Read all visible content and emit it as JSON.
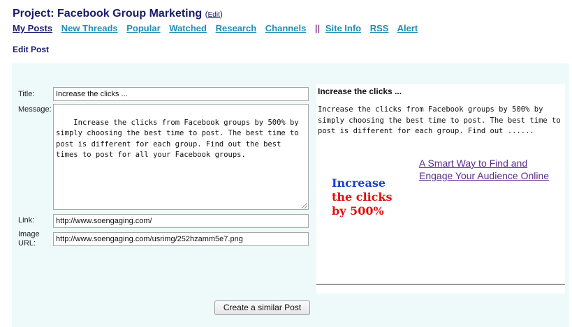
{
  "header": {
    "title": "Project: Facebook Group Marketing",
    "edit_label": "Edit",
    "paren_open": "(",
    "paren_close": ")"
  },
  "nav": {
    "items": [
      {
        "label": "My Posts"
      },
      {
        "label": "New Threads"
      },
      {
        "label": "Popular"
      },
      {
        "label": "Watched"
      },
      {
        "label": "Research"
      },
      {
        "label": "Channels"
      },
      {
        "label": "Site Info"
      },
      {
        "label": "RSS"
      },
      {
        "label": "Alert"
      }
    ],
    "separator": "||"
  },
  "section_title": "Edit Post",
  "form": {
    "title_label": "Title:",
    "title_value": "Increase the clicks ...",
    "message_label": "Message:",
    "message_value": "Increase the clicks from Facebook groups by 500% by simply choosing the best time to post. The best time to post is different for each group. Find out the best times to post for all your Facebook groups.",
    "link_label": "Link:",
    "link_value": "http://www.soengaging.com/",
    "image_label_1": "Image",
    "image_label_2": "URL:",
    "image_value": "http://www.soengaging.com/usrimg/252hzamm5e7.png",
    "submit_label": "Create a similar Post"
  },
  "preview": {
    "title": "Increase the clicks ...",
    "body": "Increase the clicks from Facebook groups by 500% by simply choosing the best time to post. The best time to post is different for each group. Find out ......",
    "link_text": "A Smart Way to Find and Engage Your Audience Online",
    "image_lines": [
      "Increase",
      "the clicks",
      "by 500%"
    ]
  },
  "colors": {
    "title": "#1a1a6e",
    "nav_link": "#1e8fb6",
    "panel_bg": "#edfaf9",
    "image_blue": "#1a3fd0",
    "image_red": "#e01010",
    "visited_link": "#5a2e8c"
  }
}
